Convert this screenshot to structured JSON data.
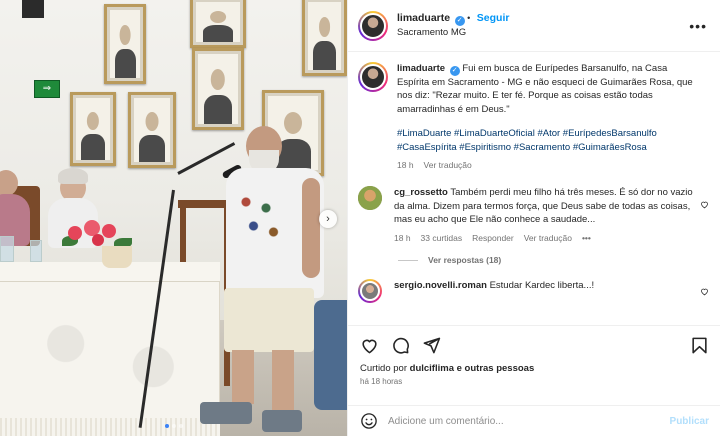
{
  "post": {
    "author": "limaduarte",
    "follow_label": "Seguir",
    "location": "Sacramento MG",
    "more_label": "•••"
  },
  "caption": {
    "username": "limaduarte",
    "text": "Fui em busca de Eurípedes Barsanulfo, na Casa Espírita em Sacramento - MG e não esqueci de Guimarães Rosa, que nos diz: \"Rezar muito. E ter fé. Porque as coisas estão todas amarradinhas é em Deus.\"",
    "hashtags": "#LimaDuarte #LimaDuarteOficial #Ator #EurípedesBarsanulfo #CasaEspírita #Espiritismo #Sacramento #GuimarãesRosa",
    "time": "18 h",
    "translate": "Ver tradução"
  },
  "comments": [
    {
      "username": "cg_rossetto",
      "text": "Também perdi meu filho há três meses. É só dor no vazio da alma. Dizem para termos força, que Deus sabe de todas as coisas, mas eu acho que Ele não conhece a saudade...",
      "time": "18 h",
      "likes": "33 curtidas",
      "reply": "Responder",
      "translate": "Ver tradução",
      "more": "•••",
      "replies": "Ver respostas (18)"
    },
    {
      "username": "sergio.novelli.roman",
      "text": "Estudar Kardec liberta...!"
    }
  ],
  "footer": {
    "liked_prefix": "Curtido por ",
    "liked_user": "dulciflima",
    "liked_suffix": " e outras pessoas",
    "posted_ago": "há 18 horas",
    "comment_placeholder": "Adicione um comentário...",
    "publish_label": "Publicar"
  },
  "photo": {
    "exit_sign": "⇒",
    "next_icon": "›",
    "slide_count": 3,
    "active_slide": 1
  },
  "colors": {
    "link": "#00376b",
    "follow": "#0095f6",
    "publish_disabled": "#b2dffc",
    "frame_gold": "#b99a5c"
  },
  "icons": [
    "heart-icon",
    "comment-icon",
    "share-icon",
    "bookmark-icon",
    "emoji-icon",
    "verified-icon",
    "chevron-right-icon"
  ]
}
